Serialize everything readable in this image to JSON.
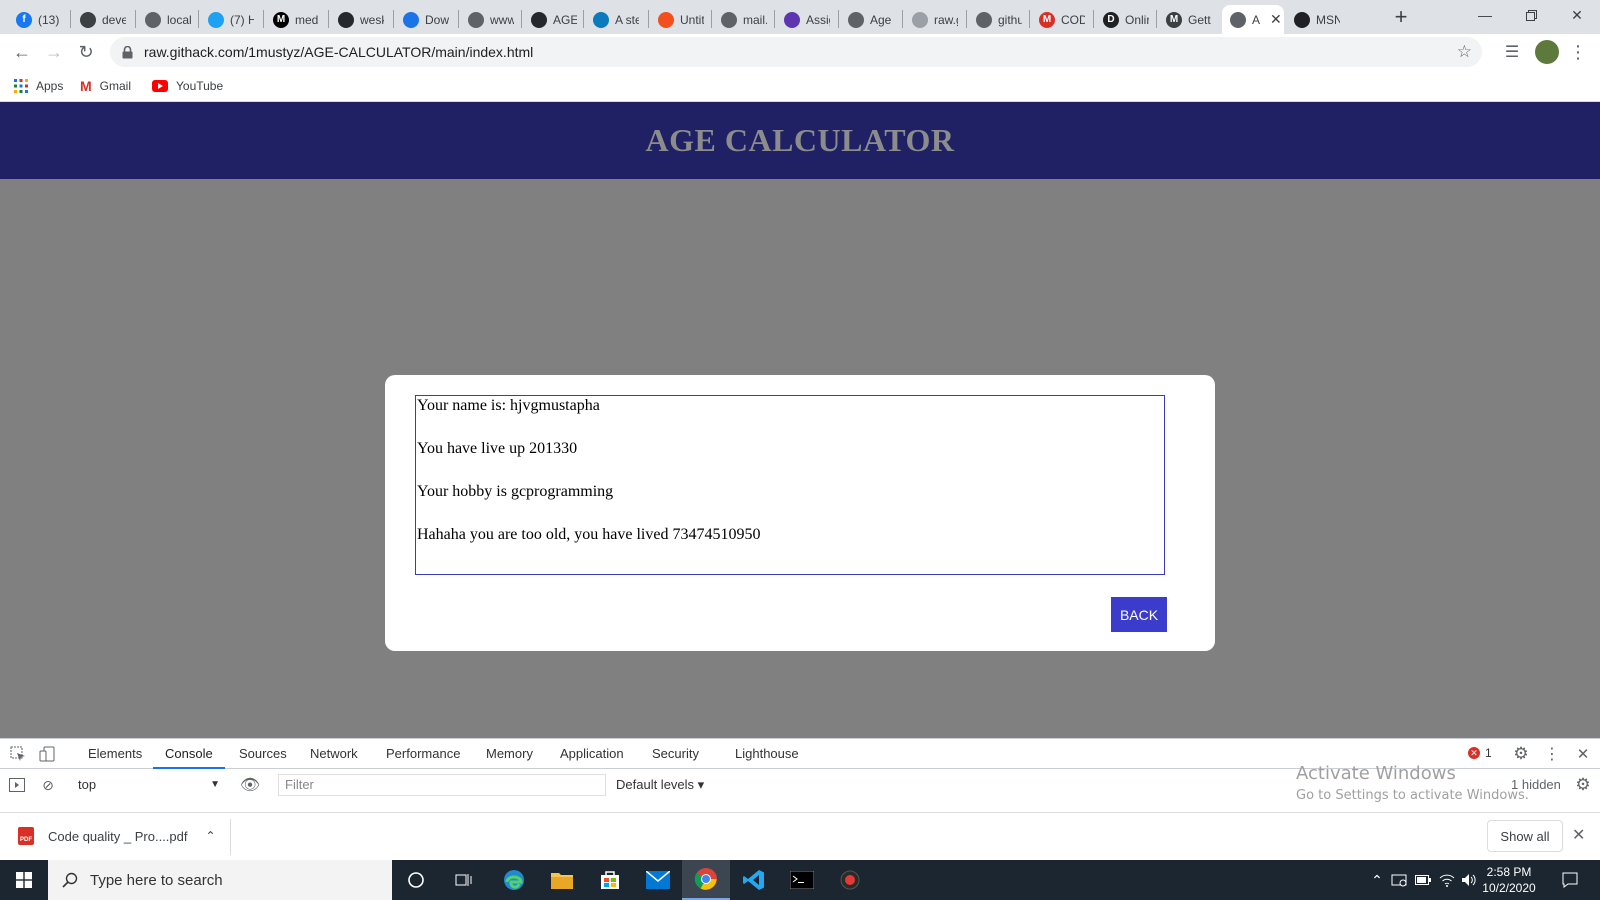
{
  "browser": {
    "tabs": [
      {
        "title": "(13)",
        "icon": "facebook-icon",
        "color": "#1877f2",
        "glyph": "f"
      },
      {
        "title": "deve",
        "icon": "dev-icon",
        "color": "#3c4043",
        "glyph": ""
      },
      {
        "title": "local",
        "icon": "globe-icon",
        "color": "#5f6368",
        "glyph": ""
      },
      {
        "title": "(7) H",
        "icon": "twitter-icon",
        "color": "#1da1f2",
        "glyph": ""
      },
      {
        "title": "med",
        "icon": "medium-icon",
        "color": "#000000",
        "glyph": "M"
      },
      {
        "title": "wesk",
        "icon": "github-icon",
        "color": "#24292e",
        "glyph": ""
      },
      {
        "title": "Dow",
        "icon": "download-icon",
        "color": "#1a73e8",
        "glyph": ""
      },
      {
        "title": "www",
        "icon": "page-icon",
        "color": "#5f6368",
        "glyph": ""
      },
      {
        "title": "AGE",
        "icon": "github-icon",
        "color": "#24292e",
        "glyph": ""
      },
      {
        "title": "A ste",
        "icon": "asset-icon",
        "color": "#0b7bbd",
        "glyph": ""
      },
      {
        "title": "Untit",
        "icon": "figma-icon",
        "color": "#f24e1e",
        "glyph": ""
      },
      {
        "title": "mail.",
        "icon": "globe-icon",
        "color": "#5f6368",
        "glyph": ""
      },
      {
        "title": "Assig",
        "icon": "form-icon",
        "color": "#5e35b1",
        "glyph": ""
      },
      {
        "title": "Age",
        "icon": "globe-icon",
        "color": "#5f6368",
        "glyph": ""
      },
      {
        "title": "raw.g",
        "icon": "cloud-icon",
        "color": "#9aa0a6",
        "glyph": ""
      },
      {
        "title": "githu",
        "icon": "globe-icon",
        "color": "#5f6368",
        "glyph": ""
      },
      {
        "title": "COD",
        "icon": "gmail-icon",
        "color": "#d93025",
        "glyph": "M"
      },
      {
        "title": "Onlin",
        "icon": "dev-d-icon",
        "color": "#202124",
        "glyph": "D"
      },
      {
        "title": "Gett",
        "icon": "m-badge-icon",
        "color": "#3c4043",
        "glyph": "M"
      },
      {
        "title": "A",
        "icon": "globe-icon",
        "color": "#5f6368",
        "glyph": ""
      },
      {
        "title": "MSN",
        "icon": "msn-icon",
        "color": "#202124",
        "glyph": ""
      }
    ],
    "active_tab_index": 19,
    "url": "raw.githack.com/1mustyz/AGE-CALCULATOR/main/index.html",
    "bookmarks": [
      {
        "label": "Apps",
        "icon": "apps-grid-icon"
      },
      {
        "label": "Gmail",
        "icon": "gmail-icon"
      },
      {
        "label": "YouTube",
        "icon": "youtube-icon"
      }
    ]
  },
  "page": {
    "title": "AGE CALCULATOR",
    "result_lines": [
      "Your name is: hjvgmustapha",
      "You have live up 201330",
      "Your hobby is gcprogramming",
      "Hahaha you are too old, you have lived 73474510950"
    ],
    "back_label": "BACK",
    "colors": {
      "header": "#1f2164",
      "overlay": "#808080",
      "button": "#3c3ccc"
    }
  },
  "devtools": {
    "tabs": [
      "Elements",
      "Console",
      "Sources",
      "Network",
      "Performance",
      "Memory",
      "Application",
      "Security",
      "Lighthouse"
    ],
    "active_tab": "Console",
    "error_count": "1",
    "context": "top",
    "filter_placeholder": "Filter",
    "levels": "Default levels",
    "hidden": "1 hidden",
    "watermark_title": "Activate Windows",
    "watermark_sub": "Go to Settings to activate Windows."
  },
  "downloads": {
    "file": "Code quality _ Pro....pdf",
    "show_all": "Show all"
  },
  "taskbar": {
    "search_placeholder": "Type here to search",
    "time": "2:58 PM",
    "date": "10/2/2020"
  }
}
